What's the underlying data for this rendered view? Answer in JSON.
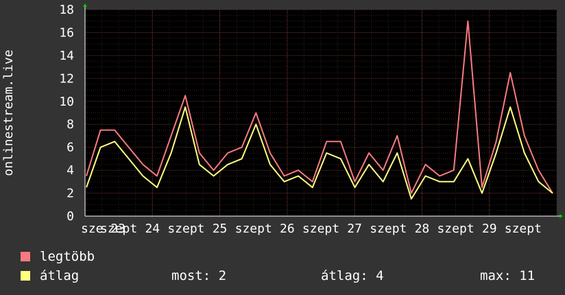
{
  "chart_data": {
    "type": "line",
    "ylabel": "onlinestream.live",
    "ylim": [
      0,
      18
    ],
    "yticks": [
      0,
      2,
      4,
      6,
      8,
      10,
      12,
      14,
      16,
      18
    ],
    "grid": true,
    "x_tick_labels": [
      "sze 23",
      "szept",
      "24",
      "szept",
      "25",
      "szept",
      "26",
      "szept",
      "27",
      "szept",
      "28",
      "szept",
      "29",
      "szept"
    ],
    "x": [
      23.0,
      23.25,
      23.5,
      23.75,
      24.0,
      24.25,
      24.5,
      24.75,
      25.0,
      25.25,
      25.5,
      25.75,
      26.0,
      26.25,
      26.5,
      26.75,
      27.0,
      27.25,
      27.5,
      27.75,
      28.0,
      28.25,
      28.5,
      28.75,
      29.0,
      29.25,
      29.5,
      29.75
    ],
    "series": [
      {
        "name": "legtöbb",
        "color": "#f77a80",
        "values": [
          3.5,
          7.5,
          7.5,
          6.0,
          4.5,
          3.5,
          7.0,
          10.5,
          5.5,
          4.0,
          5.5,
          6.0,
          9.0,
          5.5,
          3.5,
          4.0,
          3.0,
          6.5,
          6.5,
          3.0,
          5.5,
          4.0,
          7.0,
          2.0,
          4.5,
          3.5,
          4.0,
          17.0,
          2.5,
          6.5,
          12.5,
          7.0,
          4.0,
          2.0
        ]
      },
      {
        "name": "átlag",
        "color": "#ffff80",
        "values": [
          2.5,
          6.0,
          6.5,
          5.0,
          3.5,
          2.5,
          5.5,
          9.5,
          4.5,
          3.5,
          4.5,
          5.0,
          8.0,
          4.5,
          3.0,
          3.5,
          2.5,
          5.5,
          5.0,
          2.5,
          4.5,
          3.0,
          5.5,
          1.5,
          3.5,
          3.0,
          3.0,
          5.0,
          2.0,
          5.5,
          9.5,
          5.5,
          3.0,
          2.0
        ]
      }
    ]
  },
  "legend": [
    {
      "label": "legtöbb",
      "color": "#f77a80"
    },
    {
      "label": "átlag",
      "color": "#ffff80"
    }
  ],
  "stats": {
    "most": "most: 2",
    "atlag": "átlag: 4",
    "max": "max: 11"
  }
}
